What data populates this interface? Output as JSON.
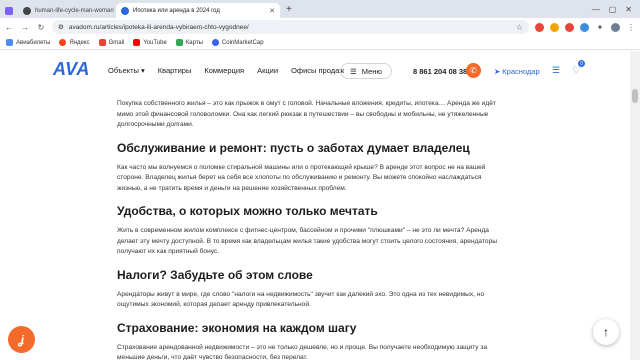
{
  "browser": {
    "tabs": [
      {
        "label": ""
      },
      {
        "label": "human-life-cycle-man-woman"
      },
      {
        "label": "Ипотека или аренда в 2024 год"
      }
    ],
    "url": "avadom.ru/articles/ipoteka-ili-arenda-vybiraem-chto-vygodnee/",
    "bookmarks": [
      "Авиабилеты",
      "Яндекс",
      "Gmail",
      "YouTube",
      "Карты",
      "CoinMarketCap"
    ]
  },
  "site": {
    "logo": "AVA",
    "nav": [
      "Объекты",
      "Квартиры",
      "Коммерция",
      "Акции",
      "Офисы продаж"
    ],
    "menu_button": "Меню",
    "phone": "8 861 204 08 38",
    "city": "Краснодар",
    "favorites_count": "0"
  },
  "article": {
    "intro": "Покупка собственного жилья – это как прыжок в омут с головой. Начальные вложения, кредиты, ипотека… Аренда же идёт мимо этой финансовой головоломки. Она как легкий рюкзак в путешествии – вы свободны и мобильны, не утяжеленные долгосрочными долгами.",
    "sections": [
      {
        "heading": "Обслуживание и ремонт: пусть о заботах думает владелец",
        "text": "Как часто мы волнуемся о поломке стиральной машины или о протекающей крыше? В аренде этот вопрос не на вашей стороне. Владелец жилья берет на себя все хлопоты по обслуживанию и ремонту. Вы можете спокойно наслаждаться жизнью, а не тратить время и деньги на решение хозяйственных проблем."
      },
      {
        "heading": "Удобства, о которых можно только мечтать",
        "text": "Жить в современном жилом комплексе с фитнес-центром, бассейном и прочими \"плюшками\" – не это ли мечта? Аренда делает эту мечту доступной. В то время как владельцам жилья такие удобства могут стоить целого состояния, арендаторы получают их как приятный бонус."
      },
      {
        "heading": "Налоги? Забудьте об этом слове",
        "text": "Арендаторы живут в мире, где слово \"налоги на недвижимость\" звучит как далекий эхо. Это одна из тех невидимых, но ощутимых экономий, которая делает аренду привлекательной."
      },
      {
        "heading": "Страхование: экономия на каждом шагу",
        "text": "Страхование арендованной недвижимости – это не только дешевле, но и проще. Вы получаете необходимую защиту за меньшие деньги, что даёт чувство безопасности, без перелат."
      }
    ]
  },
  "colors": {
    "brand": "#2c68d9",
    "accent": "#f36a2b"
  }
}
